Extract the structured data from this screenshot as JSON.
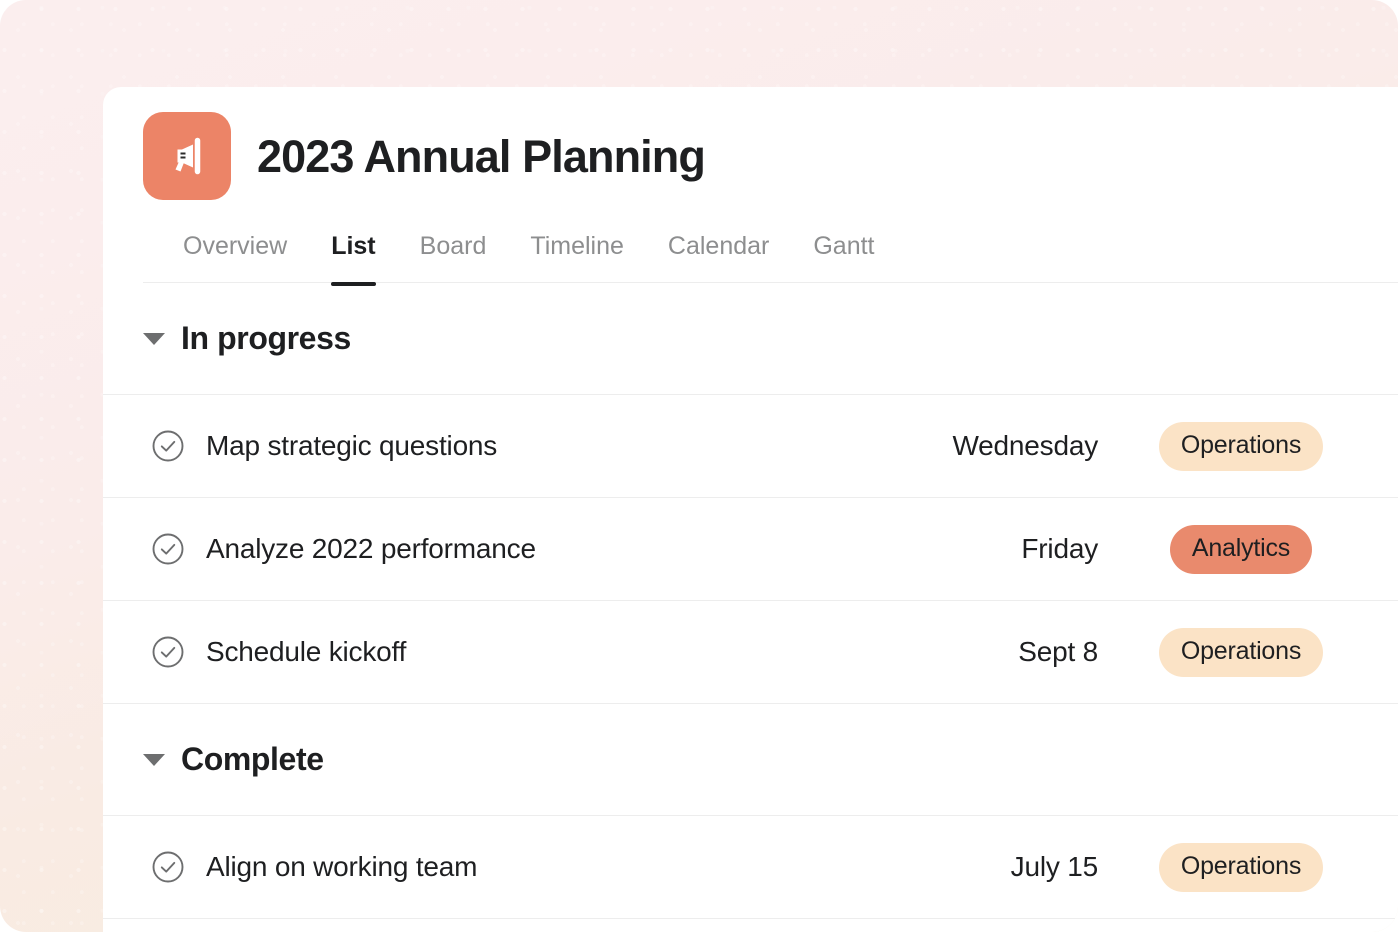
{
  "background": {
    "gradient_from": "#fbeeee",
    "gradient_to": "#f7eddf"
  },
  "header": {
    "icon": "megaphone-icon",
    "icon_bg": "#ec8467",
    "title": "2023 Annual Planning"
  },
  "tabs": [
    {
      "label": "Overview",
      "active": false
    },
    {
      "label": "List",
      "active": true
    },
    {
      "label": "Board",
      "active": false
    },
    {
      "label": "Timeline",
      "active": false
    },
    {
      "label": "Calendar",
      "active": false
    },
    {
      "label": "Gantt",
      "active": false
    }
  ],
  "tag_colors": {
    "peach": "#fbe3c6",
    "coral": "#e98a6d"
  },
  "sections": [
    {
      "title": "In progress",
      "expanded": true,
      "caret": "caret-down-icon",
      "tasks": [
        {
          "status_icon": "circle-check-icon",
          "name": "Map strategic questions",
          "date": "Wednesday",
          "tag": "Operations",
          "tag_tone": "peach"
        },
        {
          "status_icon": "circle-check-icon",
          "name": "Analyze 2022 performance",
          "date": "Friday",
          "tag": "Analytics",
          "tag_tone": "coral"
        },
        {
          "status_icon": "circle-check-icon",
          "name": "Schedule kickoff",
          "date": "Sept 8",
          "tag": "Operations",
          "tag_tone": "peach"
        }
      ]
    },
    {
      "title": "Complete",
      "expanded": true,
      "caret": "caret-down-icon",
      "tasks": [
        {
          "status_icon": "circle-check-icon",
          "name": "Align on working team",
          "date": "July 15",
          "tag": "Operations",
          "tag_tone": "peach"
        }
      ]
    }
  ]
}
